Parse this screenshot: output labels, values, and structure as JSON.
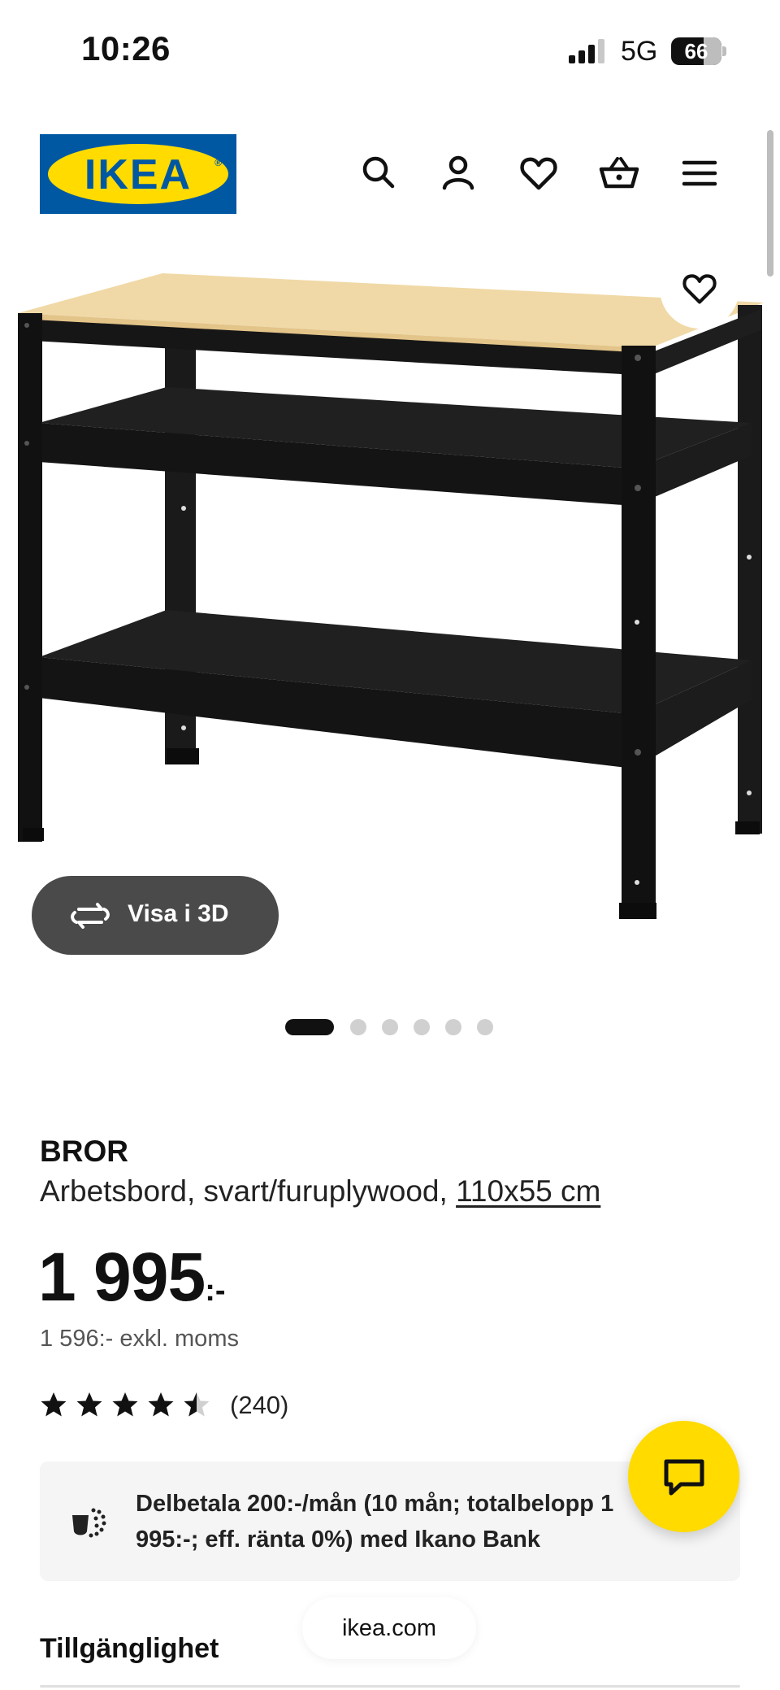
{
  "status_bar": {
    "time": "10:26",
    "network": "5G",
    "battery": "66"
  },
  "header": {
    "logo_text": "IKEA",
    "icons": [
      "search-icon",
      "account-icon",
      "heart-icon",
      "basket-icon",
      "menu-icon"
    ]
  },
  "gallery": {
    "view_3d_label": "Visa i 3D",
    "total_images": 6,
    "active_index": 0
  },
  "product": {
    "brand": "BROR",
    "description": "Arbetsbord, svart/furuplywood, ",
    "size": "110x55 cm",
    "price": "1 995",
    "price_suffix": ":-",
    "price_excl_vat": "1 596:- exkl. moms",
    "rating_value": 4.5,
    "rating_max": 5,
    "rating_count": "(240)"
  },
  "financing": {
    "text": "Delbetala 200:-/mån (10 mån; totalbelopp 1 995:-; eff. ränta 0%) med Ikano Bank"
  },
  "sections": {
    "availability_title": "Tillgänglighet"
  },
  "browser": {
    "url": "ikea.com"
  },
  "colors": {
    "ikea_blue": "#0058a3",
    "ikea_yellow": "#ffdb00",
    "button_dark": "#4a4a4a"
  }
}
